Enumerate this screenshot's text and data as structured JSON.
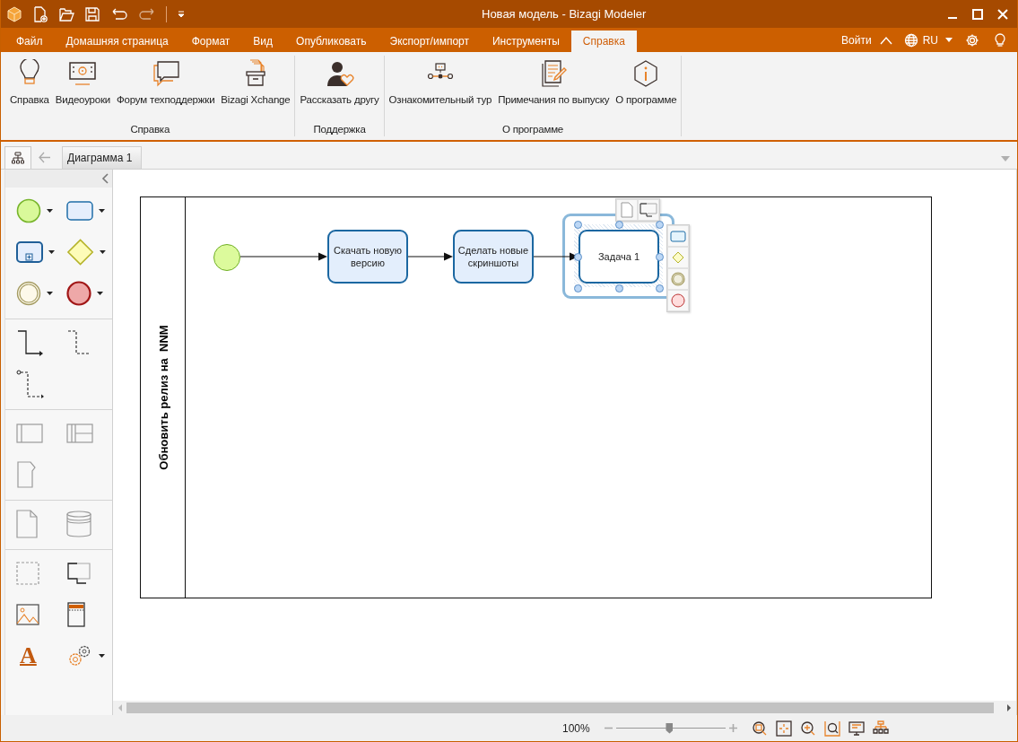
{
  "window": {
    "title": "Новая модель - Bizagi Modeler"
  },
  "menu": {
    "tabs": [
      {
        "label": "Файл",
        "selected": false
      },
      {
        "label": "Домашняя страница",
        "selected": false
      },
      {
        "label": "Формат",
        "selected": false
      },
      {
        "label": "Вид",
        "selected": false
      },
      {
        "label": "Опубликовать",
        "selected": false
      },
      {
        "label": "Экспорт/импорт",
        "selected": false
      },
      {
        "label": "Инструменты",
        "selected": false
      },
      {
        "label": "Справка",
        "selected": true
      }
    ],
    "sign_in": "Войти",
    "language": "RU"
  },
  "ribbon": {
    "groups": [
      {
        "label": "Справка",
        "buttons": [
          "Справка",
          "Видеоуроки",
          "Форум техподдержки",
          "Bizagi Xchange"
        ]
      },
      {
        "label": "Поддержка",
        "buttons": [
          "Рассказать другу"
        ]
      },
      {
        "label": "О программе",
        "buttons": [
          "Ознакомительный тур",
          "Примечания по выпуску",
          "О программе"
        ]
      }
    ]
  },
  "document_tabs": [
    {
      "label": "Диаграмма 1",
      "selected": true
    }
  ],
  "palette": {
    "text_tool": "A"
  },
  "diagram": {
    "pool_label": "Обновить релиз на  NNM",
    "nodes": [
      {
        "kind": "start"
      },
      {
        "kind": "task",
        "label": "Скачать новую версию",
        "selected": false
      },
      {
        "kind": "task",
        "label": "Сделать новые скриншоты",
        "selected": false
      },
      {
        "kind": "task",
        "label": "Задача 1",
        "selected": true
      }
    ]
  },
  "status_bar": {
    "zoom": "100%",
    "zoom_slider": {
      "level": 0.49
    }
  }
}
